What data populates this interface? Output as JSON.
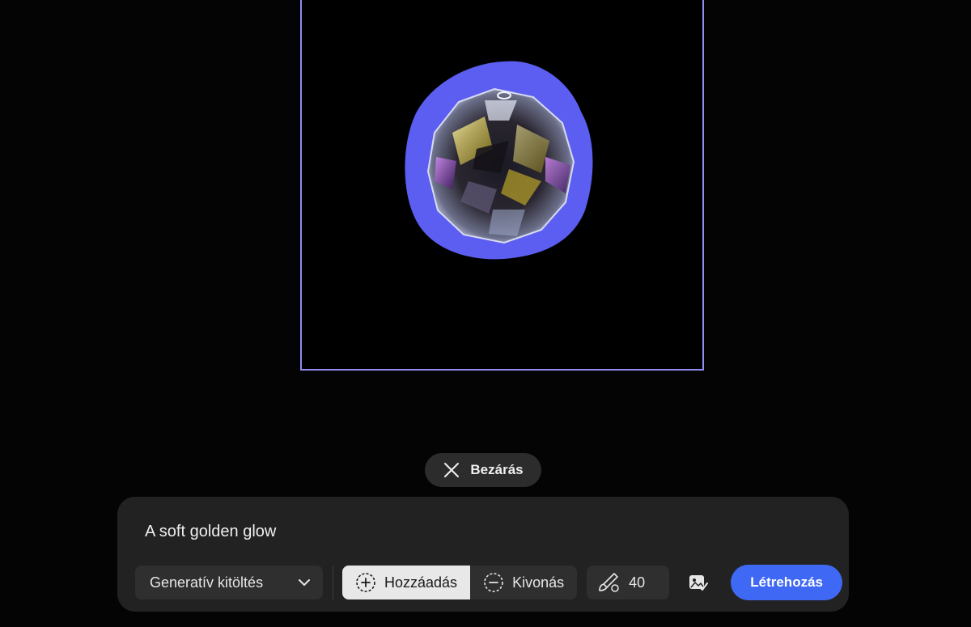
{
  "close": {
    "label": "Bezárás"
  },
  "prompt": {
    "value": "A soft golden glow",
    "placeholder": ""
  },
  "toolbar": {
    "mode": {
      "selected": "Generatív kitöltés"
    },
    "add_label": "Hozzáadás",
    "subtract_label": "Kivonás",
    "add_active": true,
    "brush_size": "40",
    "generate_label": "Létrehozás"
  },
  "colors": {
    "selection_mask": "#5b5ef0",
    "frame_border": "#8f8cf2",
    "primary_button": "#3f69f4",
    "panel_bg": "#222222"
  },
  "icons": {
    "close": "close-icon",
    "mode_dropdown": "chevron-down-icon",
    "add": "add-selection-icon",
    "subtract": "subtract-selection-icon",
    "brush": "brush-icon",
    "sample": "sample-image-icon"
  }
}
